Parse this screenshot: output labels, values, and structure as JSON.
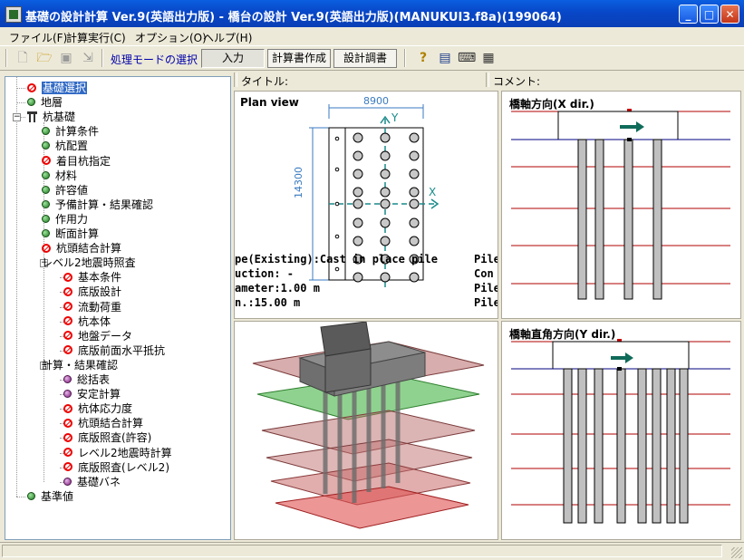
{
  "window": {
    "title": "基礎の設計計算 Ver.9(英語出力版) - 橋台の設計 Ver.9(英語出力版)(MANUKUI3.f8a)(199064)",
    "minimize_glyph": "_",
    "maximize_glyph": "□",
    "close_glyph": "✕"
  },
  "menu": [
    "ファイル(F)",
    "計算実行(C)",
    "オプション(O)",
    "ヘルプ(H)"
  ],
  "toolbar": {
    "mode_label": "処理モードの選択",
    "mode_buttons": [
      "入力",
      "計算書作成",
      "設計調書"
    ],
    "icons": [
      "new-document-icon",
      "open-folder-icon",
      "save-icon",
      "export-icon",
      "help-icon",
      "book-icon",
      "keyboard-icon",
      "calculator-icon"
    ]
  },
  "infobar": {
    "title_label": "タイトル:",
    "comment_label": "コメント:"
  },
  "tree": {
    "nodes": [
      {
        "label": "基礎選択",
        "icon": "no",
        "level": 0,
        "selected": true
      },
      {
        "label": "地層",
        "icon": "dot",
        "level": 0
      },
      {
        "label": "杭基礎",
        "icon": "pile",
        "level": 0,
        "expanded": true
      },
      {
        "label": "計算条件",
        "icon": "dot",
        "level": 1
      },
      {
        "label": "杭配置",
        "icon": "dot",
        "level": 1
      },
      {
        "label": "着目杭指定",
        "icon": "no",
        "level": 1
      },
      {
        "label": "材料",
        "icon": "dot",
        "level": 1
      },
      {
        "label": "許容値",
        "icon": "dot",
        "level": 1
      },
      {
        "label": "予備計算・結果確認",
        "icon": "dot",
        "level": 1
      },
      {
        "label": "作用力",
        "icon": "dot",
        "level": 1
      },
      {
        "label": "断面計算",
        "icon": "dot",
        "level": 1
      },
      {
        "label": "杭頭結合計算",
        "icon": "no",
        "level": 1
      },
      {
        "label": "レベル2地震時照査",
        "icon": "none",
        "level": 1,
        "expanded": true
      },
      {
        "label": "基本条件",
        "icon": "no",
        "level": 2
      },
      {
        "label": "底版設計",
        "icon": "no",
        "level": 2
      },
      {
        "label": "流動荷重",
        "icon": "no",
        "level": 2
      },
      {
        "label": "杭本体",
        "icon": "no",
        "level": 2
      },
      {
        "label": "地盤データ",
        "icon": "no",
        "level": 2
      },
      {
        "label": "底版前面水平抵抗",
        "icon": "no",
        "level": 2
      },
      {
        "label": "計算・結果確認",
        "icon": "none",
        "level": 1,
        "expanded": true
      },
      {
        "label": "総括表",
        "icon": "purple",
        "level": 2
      },
      {
        "label": "安定計算",
        "icon": "purple",
        "level": 2
      },
      {
        "label": "杭体応力度",
        "icon": "no",
        "level": 2
      },
      {
        "label": "杭頭結合計算",
        "icon": "no",
        "level": 2
      },
      {
        "label": "底版照査(許容)",
        "icon": "no",
        "level": 2
      },
      {
        "label": "レベル2地震時計算",
        "icon": "no",
        "level": 2
      },
      {
        "label": "底版照査(レベル2)",
        "icon": "no",
        "level": 2
      },
      {
        "label": "基礎バネ",
        "icon": "purple",
        "level": 2
      },
      {
        "label": "基準値",
        "icon": "dot",
        "level": 0
      }
    ]
  },
  "plan_view": {
    "title": "Plan view",
    "width_label": "8900",
    "height_label": "14300",
    "axis_y": "Y",
    "axis_x": "X",
    "lines": [
      {
        "left": "pe(Existing):Cast in place pile",
        "right": "Pile"
      },
      {
        "left": "uction:  -",
        "right": "Con"
      },
      {
        "left": "ameter:1.00 m",
        "right": "Pile"
      },
      {
        "left": "n.:15.00 m",
        "right": "Pile"
      }
    ]
  },
  "x_dir": {
    "title": "橋軸方向(X dir.)"
  },
  "y_dir": {
    "title": "橋軸直角方向(Y dir.)"
  },
  "colors": {
    "selection": "#316ac5",
    "titlebar": "#0a5fe0",
    "pile_gray": "#c0c0c0",
    "layer_red": "#b00000",
    "ground_blue": "#000080",
    "arrow_teal": "#0f6b5a"
  }
}
